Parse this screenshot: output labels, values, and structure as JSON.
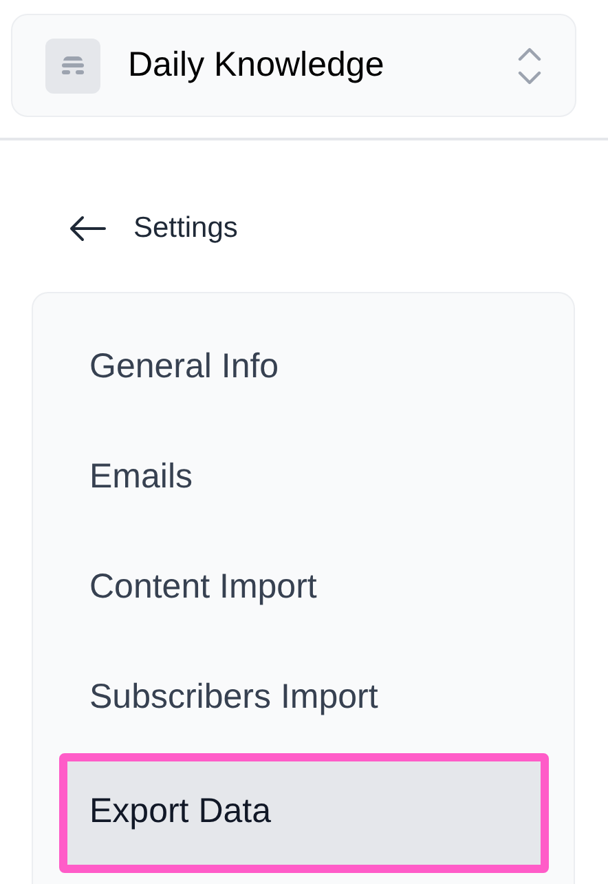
{
  "workspace": {
    "name": "Daily Knowledge"
  },
  "back": {
    "label": "Settings"
  },
  "nav": [
    {
      "label": "General Info",
      "selected": false
    },
    {
      "label": "Emails",
      "selected": false
    },
    {
      "label": "Content Import",
      "selected": false
    },
    {
      "label": "Subscribers Import",
      "selected": false
    },
    {
      "label": "Export Data",
      "selected": true
    }
  ]
}
